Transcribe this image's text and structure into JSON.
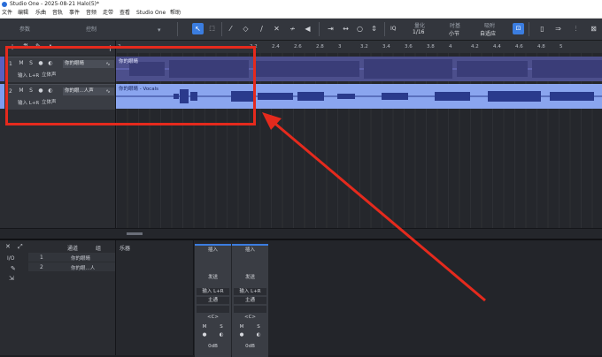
{
  "app": {
    "title": "Studio One - 2025-08-21 Halo(5)*"
  },
  "menu": [
    "文件",
    "编辑",
    "乐曲",
    "音轨",
    "事件",
    "音频",
    "走带",
    "查看",
    "Studio One",
    "帮助"
  ],
  "toolbar": {
    "param_label": "参数",
    "control_label": "控制",
    "iq_label": "IQ",
    "quantize_label": "量化",
    "quantize_value": "1/16",
    "timebase_label": "时基",
    "timebase_value": "小节",
    "snap_label": "吸附",
    "snap_value": "自适应"
  },
  "ruler": {
    "ticks": [
      "2",
      "2.2",
      "2.4",
      "2.6",
      "2.8",
      "3",
      "3.2",
      "3.4",
      "3.6",
      "3.8",
      "4",
      "4.2",
      "4.4",
      "4.6",
      "4.8",
      "5",
      "5.2",
      "5.4",
      "5.6",
      "5.8",
      "6",
      "6.2"
    ]
  },
  "tracks": [
    {
      "num": "1",
      "name": "你的眼睛",
      "input": "输入 L+R",
      "mode": "立体声",
      "color": "#5a5fc0",
      "clip_label": "你的眼睛"
    },
    {
      "num": "2",
      "name": "你的眼...人声",
      "input": "输入 L+R",
      "mode": "立体声",
      "color": "#7e9cf0",
      "clip_label": "你的眼睛 - Vocals"
    }
  ],
  "tracklist_footer": {
    "m": "M",
    "s": "S",
    "default": "标准"
  },
  "mixer": {
    "io_label": "I/O",
    "channels_header": "通道",
    "group_header": "组",
    "instruments_header": "乐器",
    "list": [
      {
        "num": "1",
        "name": "你的眼睛"
      },
      {
        "num": "2",
        "name": "你的眼...人"
      }
    ],
    "strips": [
      {
        "insert": "插入",
        "send": "发送",
        "input": "输入 L+R",
        "output": "主通",
        "pan": "<C>",
        "m": "M",
        "s": "S",
        "level": "0dB"
      },
      {
        "insert": "插入",
        "send": "发送",
        "input": "输入 L+R",
        "output": "主通",
        "pan": "<C>",
        "m": "M",
        "s": "S",
        "level": "0dB"
      }
    ]
  },
  "annotation": {
    "color": "#e52a1d"
  }
}
